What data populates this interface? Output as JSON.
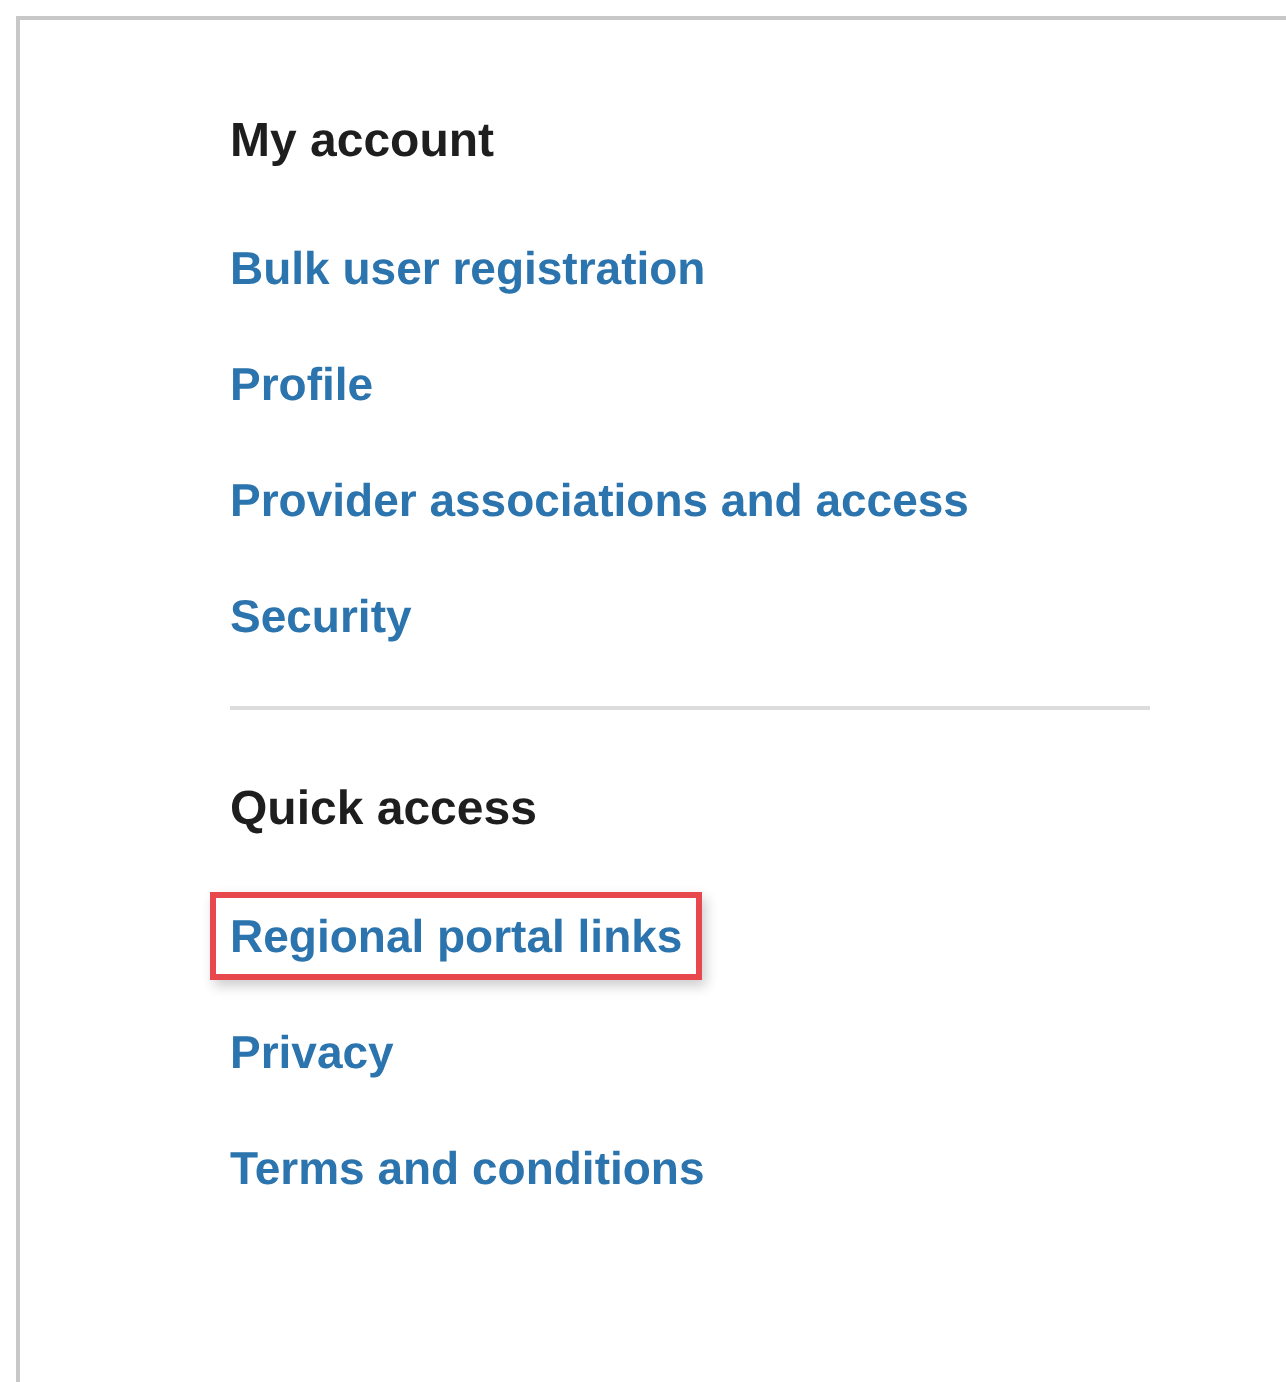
{
  "sections": [
    {
      "title": "My account",
      "links": [
        {
          "label": "Bulk user registration",
          "highlighted": false
        },
        {
          "label": "Profile",
          "highlighted": false
        },
        {
          "label": "Provider associations and access",
          "highlighted": false
        },
        {
          "label": "Security",
          "highlighted": false
        }
      ]
    },
    {
      "title": "Quick access",
      "links": [
        {
          "label": "Regional portal links",
          "highlighted": true
        },
        {
          "label": "Privacy",
          "highlighted": false
        },
        {
          "label": "Terms and conditions",
          "highlighted": false
        }
      ]
    }
  ]
}
